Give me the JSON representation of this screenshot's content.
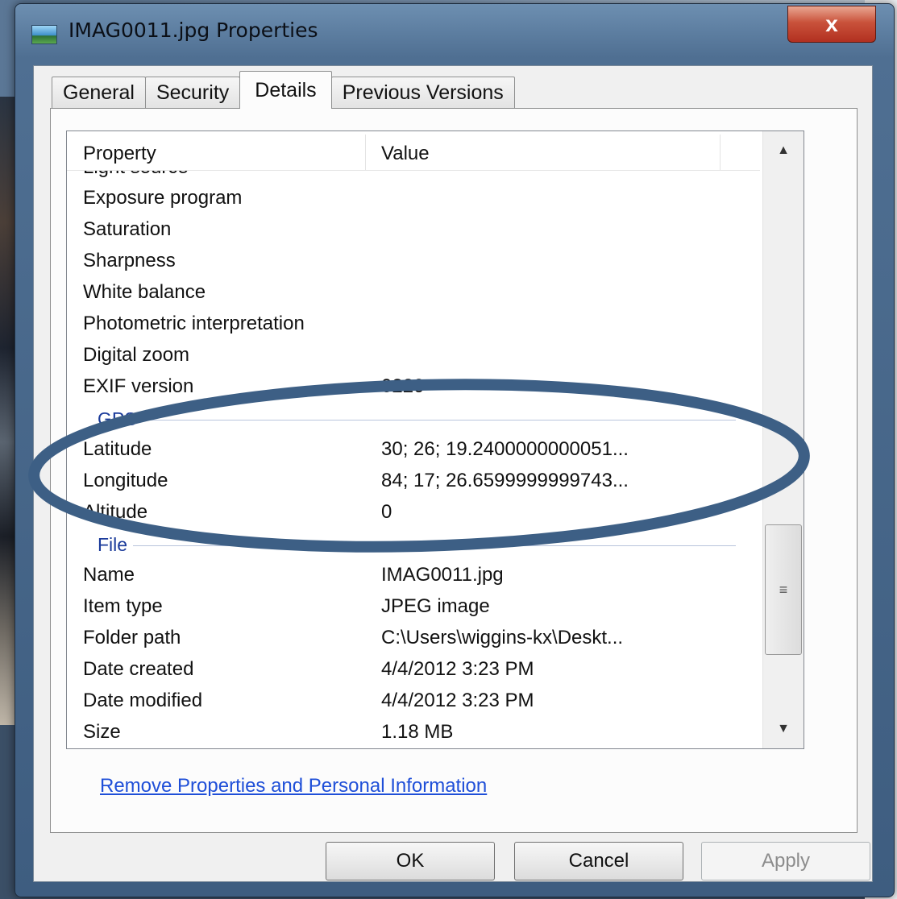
{
  "window": {
    "title": "IMAG0011.jpg Properties",
    "close_label": "x"
  },
  "tabs": [
    {
      "label": "General",
      "active": false
    },
    {
      "label": "Security",
      "active": false
    },
    {
      "label": "Details",
      "active": true
    },
    {
      "label": "Previous Versions",
      "active": false
    }
  ],
  "list": {
    "columns": {
      "property": "Property",
      "value": "Value"
    },
    "partial_top": "Light source",
    "rows_a": [
      {
        "property": "Exposure program",
        "value": ""
      },
      {
        "property": "Saturation",
        "value": ""
      },
      {
        "property": "Sharpness",
        "value": ""
      },
      {
        "property": "White balance",
        "value": ""
      },
      {
        "property": "Photometric interpretation",
        "value": ""
      },
      {
        "property": "Digital zoom",
        "value": ""
      },
      {
        "property": "EXIF version",
        "value": "0220"
      }
    ],
    "group_gps": "GPS",
    "rows_gps": [
      {
        "property": "Latitude",
        "value": "30; 26; 19.2400000000051..."
      },
      {
        "property": "Longitude",
        "value": "84; 17; 26.6599999999743..."
      },
      {
        "property": "Altitude",
        "value": "0"
      }
    ],
    "group_file": "File",
    "rows_file": [
      {
        "property": "Name",
        "value": "IMAG0011.jpg"
      },
      {
        "property": "Item type",
        "value": "JPEG image"
      },
      {
        "property": "Folder path",
        "value": "C:\\Users\\wiggins-kx\\Deskt..."
      },
      {
        "property": "Date created",
        "value": "4/4/2012 3:23 PM"
      },
      {
        "property": "Date modified",
        "value": "4/4/2012 3:23 PM"
      },
      {
        "property": "Size",
        "value": "1.18 MB"
      }
    ],
    "scroll_up_icon": "▲",
    "scroll_down_icon": "▼",
    "scroll_grip_icon": "≡"
  },
  "remove_link": "Remove Properties and Personal Information",
  "buttons": {
    "ok": "OK",
    "cancel": "Cancel",
    "apply": "Apply"
  },
  "colors": {
    "annotation_ellipse": "#3d5f85",
    "link": "#1f4fd8",
    "group_header": "#1a3a9a"
  }
}
